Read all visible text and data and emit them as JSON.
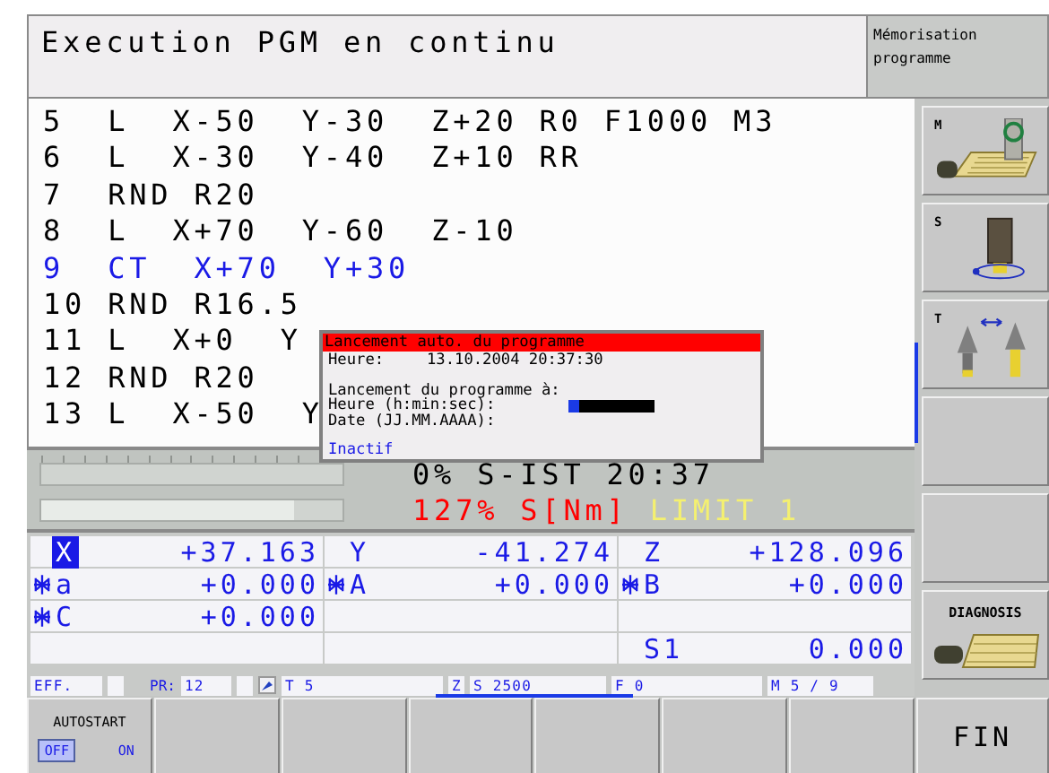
{
  "header": {
    "title": "Execution PGM en continu",
    "mode": [
      "Mémorisation",
      "programme"
    ]
  },
  "program": {
    "lines": [
      {
        "text": "5  L  X-50  Y-30  Z+20 R0 F1000 M3",
        "current": false
      },
      {
        "text": "6  L  X-30  Y-40  Z+10 RR",
        "current": false
      },
      {
        "text": "7  RND R20",
        "current": false
      },
      {
        "text": "8  L  X+70  Y-60  Z-10",
        "current": false
      },
      {
        "text": "9  CT  X+70  Y+30",
        "current": true
      },
      {
        "text": "10 RND R16.5",
        "current": false
      },
      {
        "text": "11 L  X+0  Y",
        "current": false
      },
      {
        "text": "12 RND R20",
        "current": false
      },
      {
        "text": "13 L  X-50  Y",
        "current": false
      }
    ]
  },
  "dialog": {
    "title": "Lancement auto. du programme",
    "time_label": "Heure:",
    "time_value": "13.10.2004 20:37:30",
    "heading": "Lancement du programme à:",
    "fields": [
      {
        "label": "Heure (h:min:sec):",
        "kind": "input"
      },
      {
        "label": "Date (JJ.MM.AAAA):",
        "kind": "none"
      }
    ],
    "status": "Inactif"
  },
  "gauges": [
    {
      "level": 0,
      "readings": [
        {
          "text": "0%",
          "color": "#000000"
        },
        {
          "text": "S-IST",
          "color": "#000000"
        },
        {
          "text": "20:37",
          "color": "#000000"
        }
      ]
    },
    {
      "level": 0.84,
      "readings": [
        {
          "text": "127%",
          "color": "#ff0000"
        },
        {
          "text": "S[Nm]",
          "color": "#ff0000"
        },
        {
          "text": "LIMIT 1",
          "color": "#f4f070"
        }
      ]
    }
  ],
  "positions": [
    [
      {
        "kind": "axis",
        "axis": "X",
        "value": "+37.163",
        "selected": true,
        "marked": false
      },
      {
        "kind": "axis",
        "axis": "Y",
        "value": "-41.274",
        "selected": false,
        "marked": false
      },
      {
        "kind": "axis",
        "axis": "Z",
        "value": "+128.096",
        "selected": false,
        "marked": false
      }
    ],
    [
      {
        "kind": "axis",
        "axis": "a",
        "value": "+0.000",
        "selected": false,
        "marked": true
      },
      {
        "kind": "axis",
        "axis": "A",
        "value": "+0.000",
        "selected": false,
        "marked": true
      },
      {
        "kind": "axis",
        "axis": "B",
        "value": "+0.000",
        "selected": false,
        "marked": true
      }
    ],
    [
      {
        "kind": "axis",
        "axis": "C",
        "value": "+0.000",
        "selected": false,
        "marked": true
      },
      {
        "kind": "blank"
      },
      {
        "kind": "blank"
      }
    ],
    [
      {
        "kind": "blank"
      },
      {
        "kind": "blank"
      },
      {
        "kind": "axis",
        "axis": "S1",
        "value": "0.000",
        "selected": false,
        "marked": false
      }
    ]
  ],
  "status_line": [
    {
      "kind": "box",
      "text": "EFF."
    },
    {
      "kind": "empty"
    },
    {
      "kind": "label",
      "text": "PR:"
    },
    {
      "kind": "box",
      "text": "12"
    },
    {
      "kind": "empty"
    },
    {
      "kind": "icon"
    },
    {
      "kind": "box",
      "text": "T 5"
    },
    {
      "kind": "box",
      "text": "Z"
    },
    {
      "kind": "box",
      "text": "S 2500"
    },
    {
      "kind": "box",
      "text": "F 0"
    },
    {
      "kind": "box",
      "text": "M 5 / 9"
    }
  ],
  "side_softkeys": [
    {
      "kind": "machine",
      "label": "M"
    },
    {
      "kind": "spindle",
      "label": "S"
    },
    {
      "kind": "tool",
      "label": "T"
    },
    {
      "kind": "blank"
    },
    {
      "kind": "blank"
    },
    {
      "kind": "diagnosis",
      "label": "DIAGNOSIS"
    }
  ],
  "softkeys": [
    {
      "kind": "toggle",
      "label": "AUTOSTART",
      "options": [
        {
          "label": "OFF",
          "selected": true
        },
        {
          "label": "ON",
          "selected": false
        }
      ]
    },
    {
      "kind": "blank"
    },
    {
      "kind": "blank"
    },
    {
      "kind": "blank"
    },
    {
      "kind": "blank"
    },
    {
      "kind": "blank"
    },
    {
      "kind": "blank"
    },
    {
      "kind": "text",
      "label": "FIN"
    }
  ]
}
